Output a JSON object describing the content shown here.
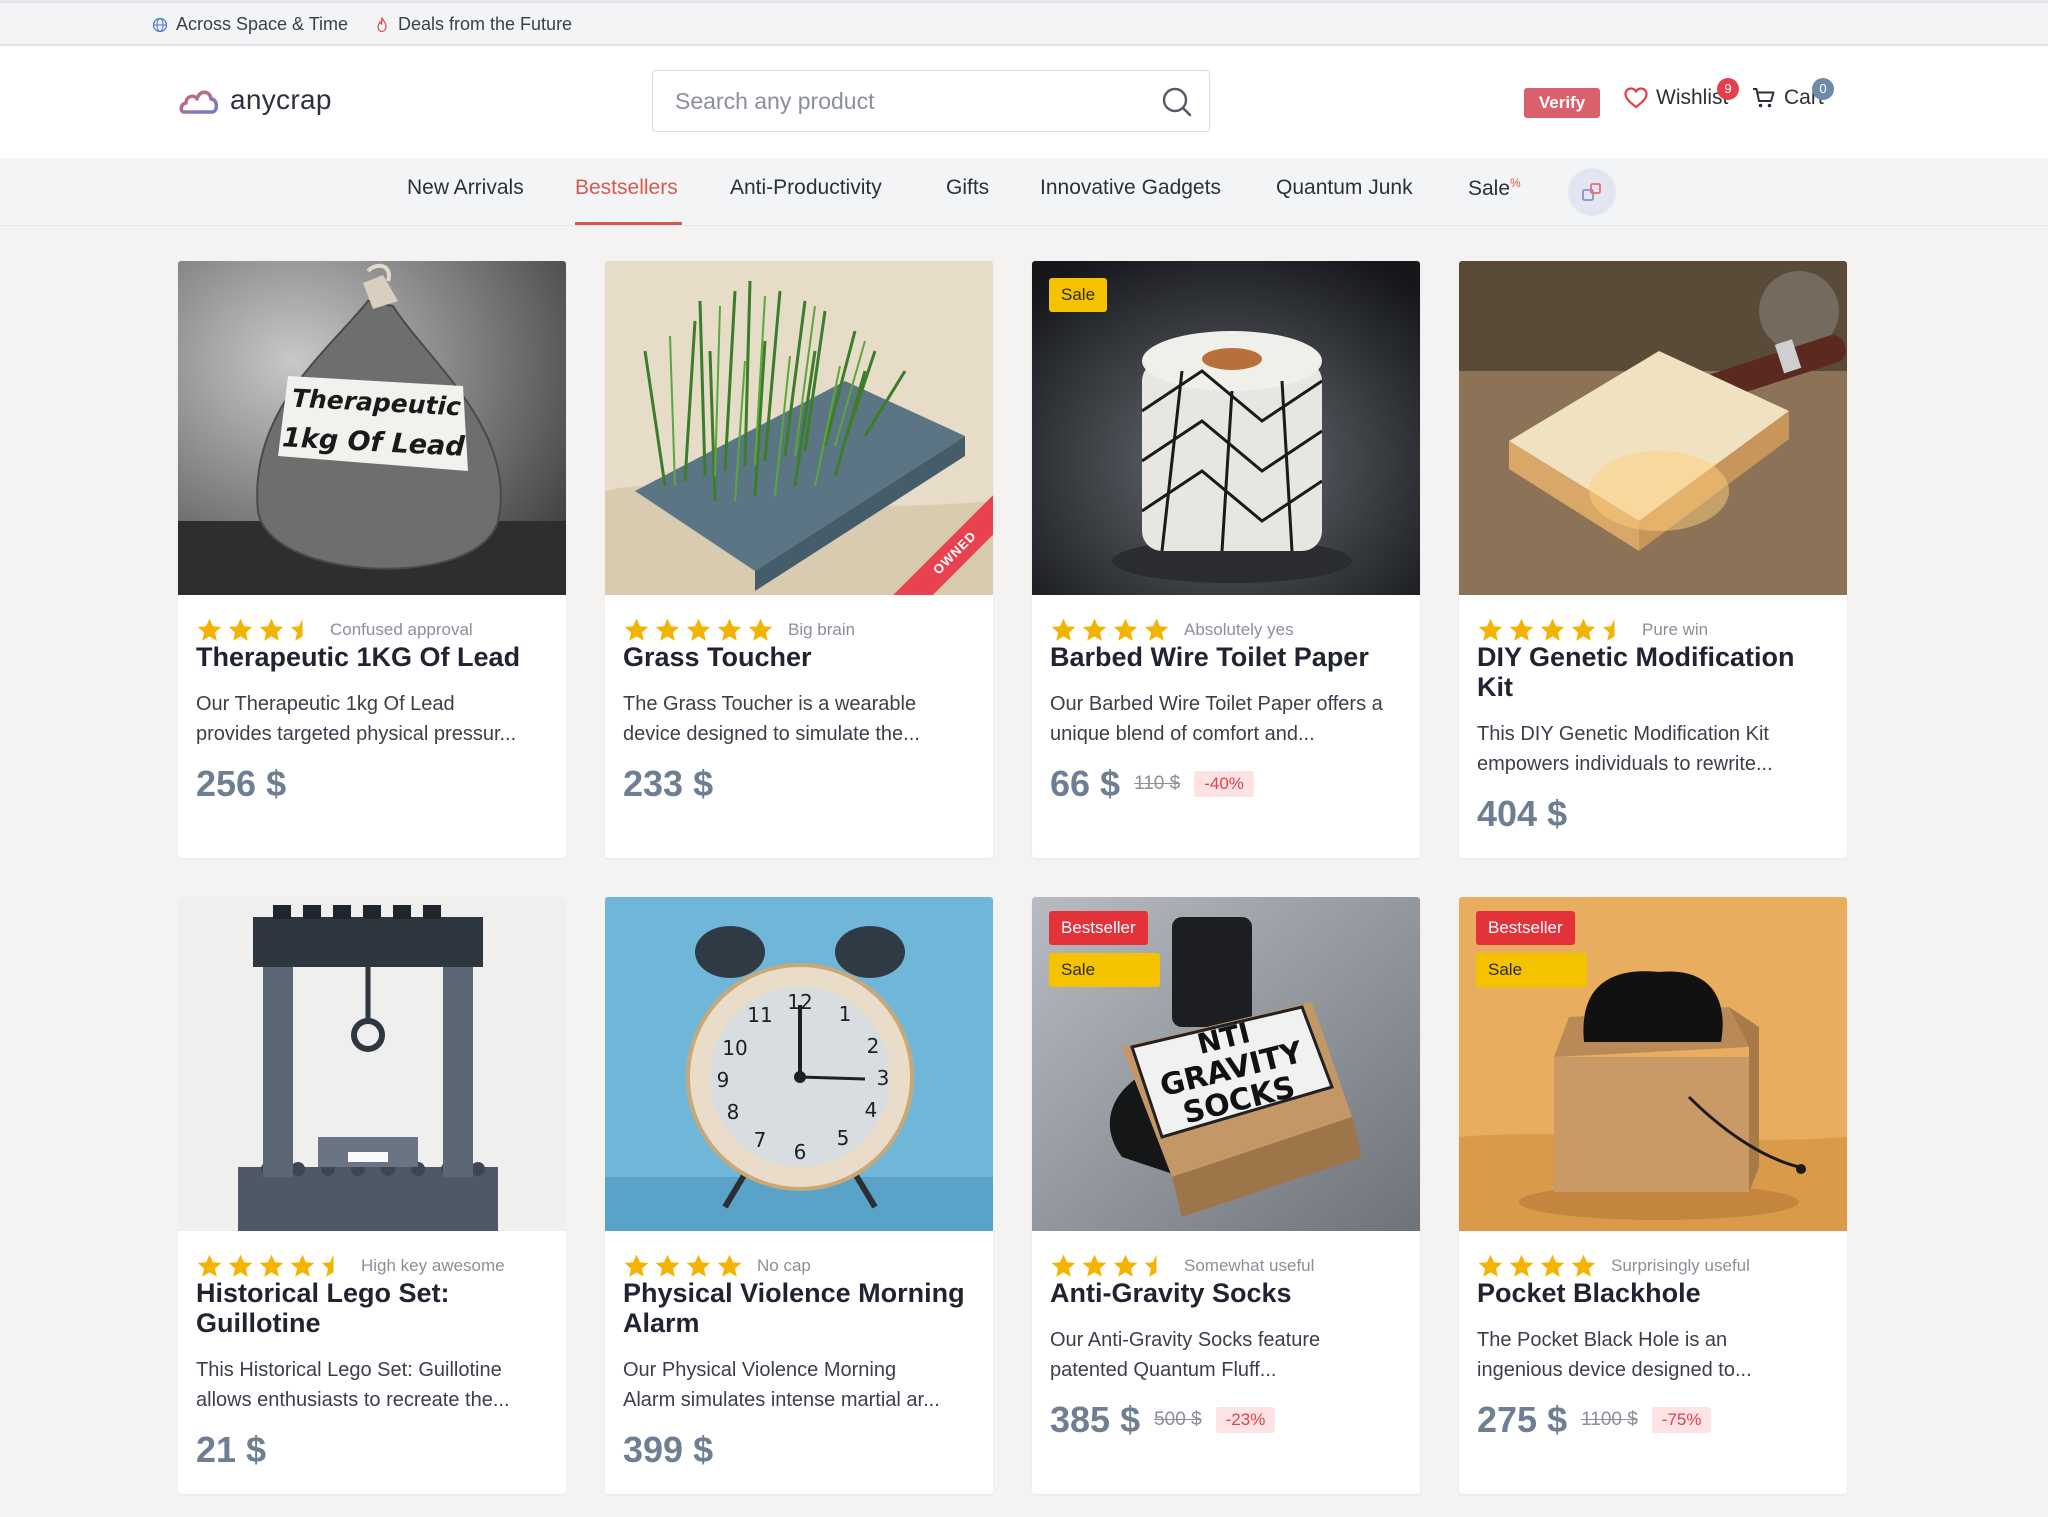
{
  "topbar": {
    "left_text": "Across Space & Time",
    "right_text": "Deals from the Future"
  },
  "header": {
    "logo_text": "anycrap",
    "search_placeholder": "Search any product",
    "verify_label": "Verify",
    "wishlist_label": "Wishlist",
    "wishlist_count": "9",
    "cart_label": "Cart",
    "cart_count": "0"
  },
  "nav": {
    "items": [
      {
        "label": "New Arrivals"
      },
      {
        "label": "Bestsellers"
      },
      {
        "label": "Anti-Productivity"
      },
      {
        "label": "Gifts"
      },
      {
        "label": "Innovative Gadgets"
      },
      {
        "label": "Quantum Junk"
      },
      {
        "label": "Sale"
      }
    ],
    "active": "Bestsellers",
    "sale_sup": "%"
  },
  "products": [
    {
      "title": "Therapeutic 1KG Of Lead",
      "rating": 3.5,
      "rating_label": "Confused approval",
      "desc": [
        "Our Therapeutic 1kg Of Lead",
        "provides targeted physical pressur..."
      ],
      "price": "256 $",
      "image_text": [
        "Therapeutic",
        "1kg Of Lead"
      ]
    },
    {
      "title": "Grass Toucher",
      "rating": 5,
      "rating_label": "Big brain",
      "desc": [
        "The Grass Toucher is a wearable",
        "device designed to simulate the..."
      ],
      "price": "233 $",
      "owned_label": "OWNED"
    },
    {
      "title": "Barbed Wire Toilet Paper",
      "rating": 4,
      "rating_label": "Absolutely yes",
      "desc": [
        "Our Barbed Wire Toilet Paper offers a",
        "unique blend of comfort and..."
      ],
      "price": "66 $",
      "old_price": "110 $",
      "discount": "-40%",
      "sale_tag": "Sale"
    },
    {
      "title": "DIY Genetic Modification Kit",
      "rating": 4.5,
      "rating_label": "Pure win",
      "desc": [
        "This DIY Genetic Modification Kit",
        "empowers individuals to rewrite..."
      ],
      "price": "404 $"
    },
    {
      "title": "Historical Lego Set: Guillotine",
      "rating": 4.5,
      "rating_label": "High key awesome",
      "desc": [
        "This Historical Lego Set: Guillotine",
        "allows enthusiasts to recreate the..."
      ],
      "price": "21 $"
    },
    {
      "title": "Physical Violence Morning Alarm",
      "rating": 4,
      "rating_label": "No cap",
      "desc": [
        "Our Physical Violence Morning",
        "Alarm simulates intense martial ar..."
      ],
      "price": "399 $"
    },
    {
      "title": "Anti-Gravity Socks",
      "rating": 3.5,
      "rating_label": "Somewhat useful",
      "desc": [
        "Our Anti-Gravity Socks feature",
        "patented Quantum Fluff..."
      ],
      "price": "385 $",
      "old_price": "500 $",
      "discount": "-23%",
      "best_tag": "Bestseller",
      "sale_tag": "Sale",
      "image_text": [
        "NTI",
        "GRAVITY",
        "SOCKS"
      ]
    },
    {
      "title": "Pocket Blackhole",
      "rating": 4,
      "rating_label": "Surprisingly useful",
      "desc": [
        "The Pocket Black Hole is an",
        "ingenious device designed to..."
      ],
      "price": "275 $",
      "old_price": "1100 $",
      "discount": "-75%",
      "best_tag": "Bestseller",
      "sale_tag": "Sale"
    }
  ],
  "colors": {
    "accent": "#d85a4f",
    "star": "#f5b301",
    "price": "#6f7f93",
    "sale_tag": "#f5c200",
    "bestseller_tag": "#e3323a"
  }
}
